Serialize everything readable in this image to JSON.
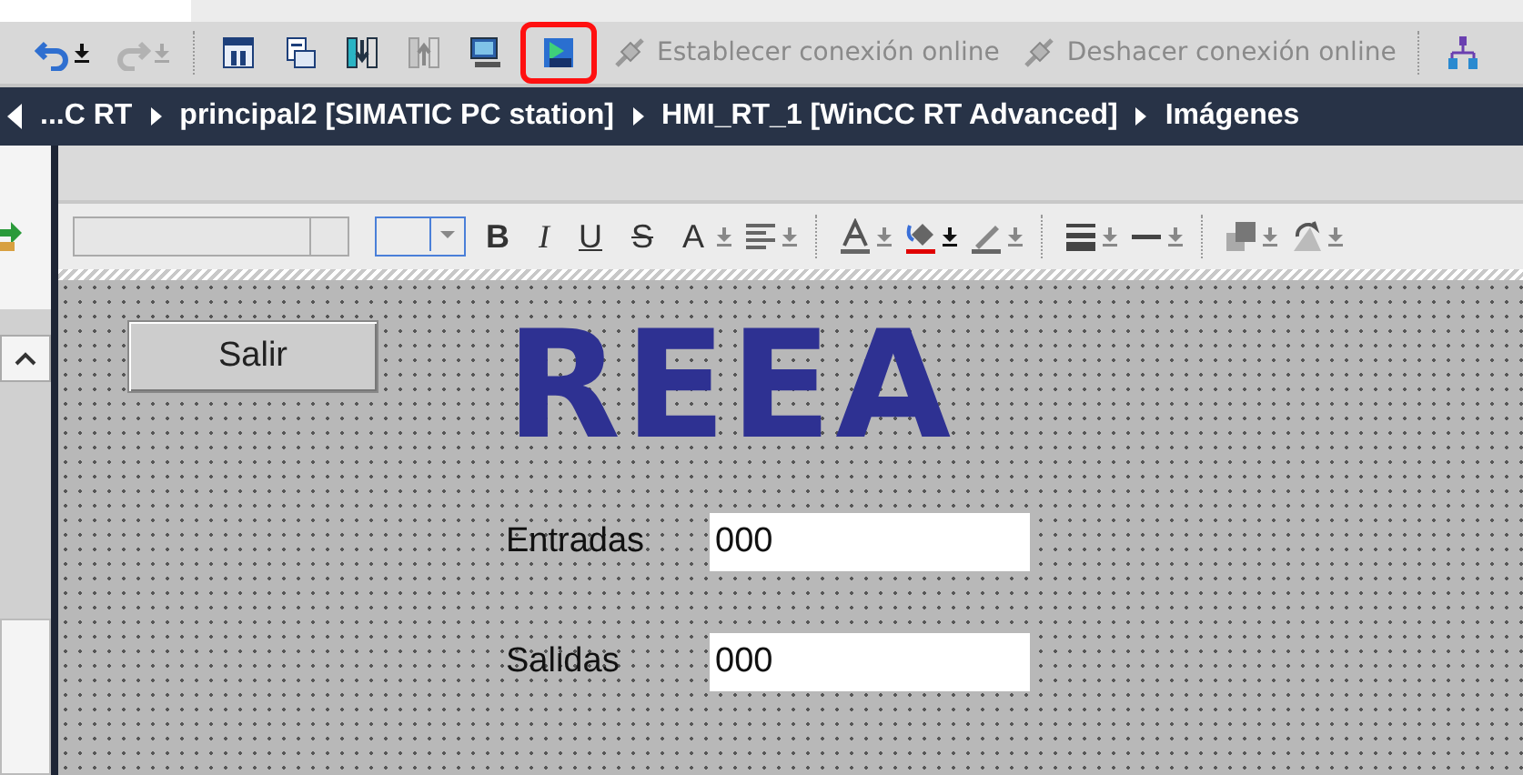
{
  "toolbar": {
    "items": [
      {
        "kind": "icon",
        "disabled": false,
        "highlighted": false
      },
      {
        "kind": "icon",
        "disabled": true,
        "highlighted": false
      },
      {
        "kind": "separator"
      },
      {
        "kind": "icon",
        "disabled": false,
        "highlighted": false
      },
      {
        "kind": "icon",
        "disabled": false,
        "highlighted": false
      },
      {
        "kind": "icon",
        "disabled": false,
        "highlighted": false
      },
      {
        "kind": "icon",
        "disabled": true,
        "highlighted": false
      },
      {
        "kind": "icon",
        "disabled": false,
        "highlighted": false
      },
      {
        "kind": "icon",
        "disabled": false,
        "highlighted": true
      },
      {
        "kind": "action",
        "label": "Establecer conexión online",
        "disabled": true
      },
      {
        "kind": "action",
        "label": "Deshacer conexión online",
        "disabled": true
      },
      {
        "kind": "separator"
      },
      {
        "kind": "icon",
        "disabled": false,
        "highlighted": false
      }
    ]
  },
  "breadcrumb": [
    "...C RT",
    "principal2 [SIMATIC PC station]",
    "HMI_RT_1 [WinCC RT Advanced]",
    "Imágenes"
  ],
  "format_toolbar": {
    "items": [
      {
        "kind": "combo"
      },
      {
        "kind": "dropdown"
      },
      {
        "kind": "letter",
        "label": "B"
      },
      {
        "kind": "letter",
        "label": "I"
      },
      {
        "kind": "letter",
        "label": "U"
      },
      {
        "kind": "letter",
        "label": "S"
      },
      {
        "kind": "letter",
        "label": "A"
      },
      {
        "kind": "icon"
      },
      {
        "kind": "separator"
      },
      {
        "kind": "icon"
      },
      {
        "kind": "icon"
      },
      {
        "kind": "icon"
      },
      {
        "kind": "separator"
      },
      {
        "kind": "icon"
      },
      {
        "kind": "icon"
      },
      {
        "kind": "separator"
      },
      {
        "kind": "icon"
      },
      {
        "kind": "icon"
      }
    ]
  },
  "screen": {
    "button": "Salir",
    "title": "REEA",
    "fields": [
      {
        "label": "Entradas",
        "value": "000"
      },
      {
        "label": "Salidas",
        "value": "000"
      }
    ]
  }
}
